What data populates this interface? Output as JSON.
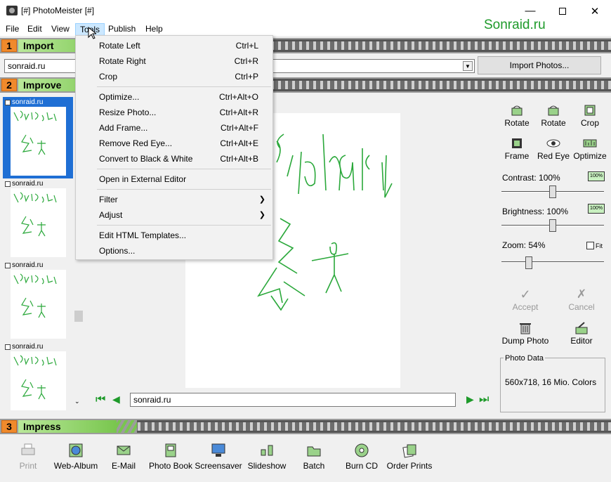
{
  "window": {
    "title": "[#] PhotoMeister [#]"
  },
  "menubar": [
    "File",
    "Edit",
    "View",
    "Tools",
    "Publish",
    "Help"
  ],
  "watermark": "Sonraid.ru",
  "sections": {
    "import": {
      "num": "1",
      "label": "Import"
    },
    "improve": {
      "num": "2",
      "label": "Improve"
    },
    "impress": {
      "num": "3",
      "label": "Impress"
    }
  },
  "import_row": {
    "path_value": "sonraid.ru",
    "import_button": "Import Photos..."
  },
  "thumbnails": [
    {
      "label": "sonraid.ru",
      "selected": true
    },
    {
      "label": "sonraid.ru",
      "selected": false
    },
    {
      "label": "sonraid.ru",
      "selected": false
    },
    {
      "label": "sonraid.ru",
      "selected": false
    }
  ],
  "viewer": {
    "filename": "sonraid.ru"
  },
  "tools": {
    "rotate_left": "Rotate",
    "rotate_right": "Rotate",
    "crop": "Crop",
    "frame": "Frame",
    "red_eye": "Red Eye",
    "optimize": "Optimize",
    "contrast": "Contrast: 100%",
    "brightness": "Brightness: 100%",
    "zoom": "Zoom: 54%",
    "fit": "Fit",
    "contrast_level": 1.0,
    "brightness_level": 1.0,
    "zoom_level": 0.54,
    "badge": "100%",
    "accept": "Accept",
    "cancel": "Cancel",
    "dump_photo": "Dump Photo",
    "editor": "Editor",
    "photo_data_legend": "Photo Data",
    "photo_data_value": "560x718, 16 Mio. Colors"
  },
  "impress": [
    {
      "label": "Print",
      "disabled": true
    },
    {
      "label": "Web-Album"
    },
    {
      "label": "E-Mail"
    },
    {
      "label": "Photo Book"
    },
    {
      "label": "Screensaver"
    },
    {
      "label": "Slideshow"
    },
    {
      "label": "Batch"
    },
    {
      "label": "Burn CD"
    },
    {
      "label": "Order Prints"
    }
  ],
  "tools_menu": {
    "rotate_left": {
      "label": "Rotate Left",
      "shortcut": "Ctrl+L"
    },
    "rotate_right": {
      "label": "Rotate Right",
      "shortcut": "Ctrl+R"
    },
    "crop": {
      "label": "Crop",
      "shortcut": "Ctrl+P"
    },
    "optimize": {
      "label": "Optimize...",
      "shortcut": "Ctrl+Alt+O"
    },
    "resize": {
      "label": "Resize Photo...",
      "shortcut": "Ctrl+Alt+R"
    },
    "add_frame": {
      "label": "Add Frame...",
      "shortcut": "Ctrl+Alt+F"
    },
    "red_eye": {
      "label": "Remove Red Eye...",
      "shortcut": "Ctrl+Alt+E"
    },
    "bw": {
      "label": "Convert to Black & White",
      "shortcut": "Ctrl+Alt+B"
    },
    "external": {
      "label": "Open in External Editor"
    },
    "filter": {
      "label": "Filter"
    },
    "adjust": {
      "label": "Adjust"
    },
    "html_templates": {
      "label": "Edit HTML Templates..."
    },
    "options": {
      "label": "Options..."
    }
  },
  "colors": {
    "accent_green": "#1e9a2a",
    "section_orange": "#f08a2c",
    "selection_blue": "#1f6fd4"
  }
}
